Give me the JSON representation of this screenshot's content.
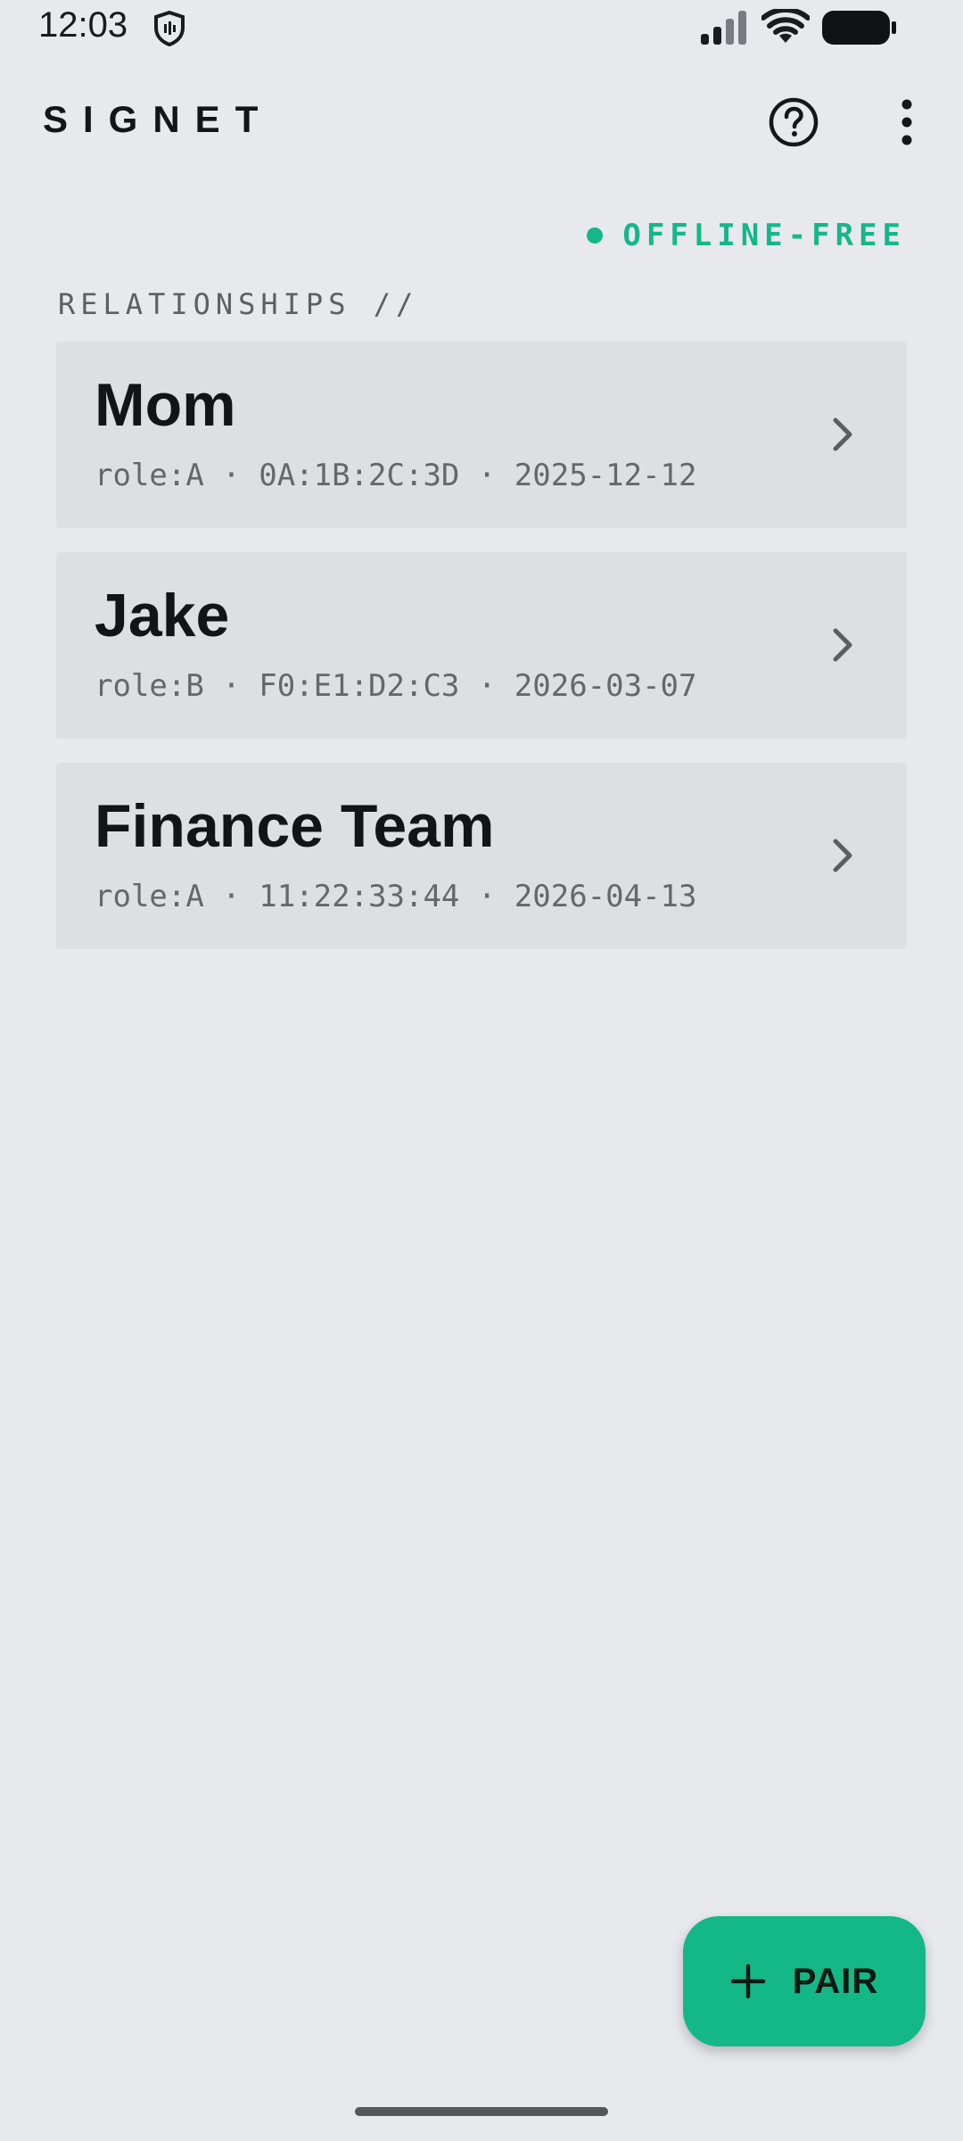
{
  "status_bar": {
    "time": "12:03"
  },
  "app_bar": {
    "title": "SIGNET"
  },
  "connection_status": {
    "label": "OFFLINE-FREE",
    "color": "#13B886"
  },
  "section": {
    "label": "RELATIONSHIPS //"
  },
  "relationships": [
    {
      "name": "Mom",
      "meta": "role:A · 0A:1B:2C:3D · 2025-12-12"
    },
    {
      "name": "Jake",
      "meta": "role:B · F0:E1:D2:C3 · 2026-03-07"
    },
    {
      "name": "Finance Team",
      "meta": "role:A · 11:22:33:44 · 2026-04-13"
    }
  ],
  "fab": {
    "label": "PAIR"
  },
  "colors": {
    "background": "#E8E9ED",
    "card": "#DEDFE3",
    "accent": "#13B886"
  }
}
